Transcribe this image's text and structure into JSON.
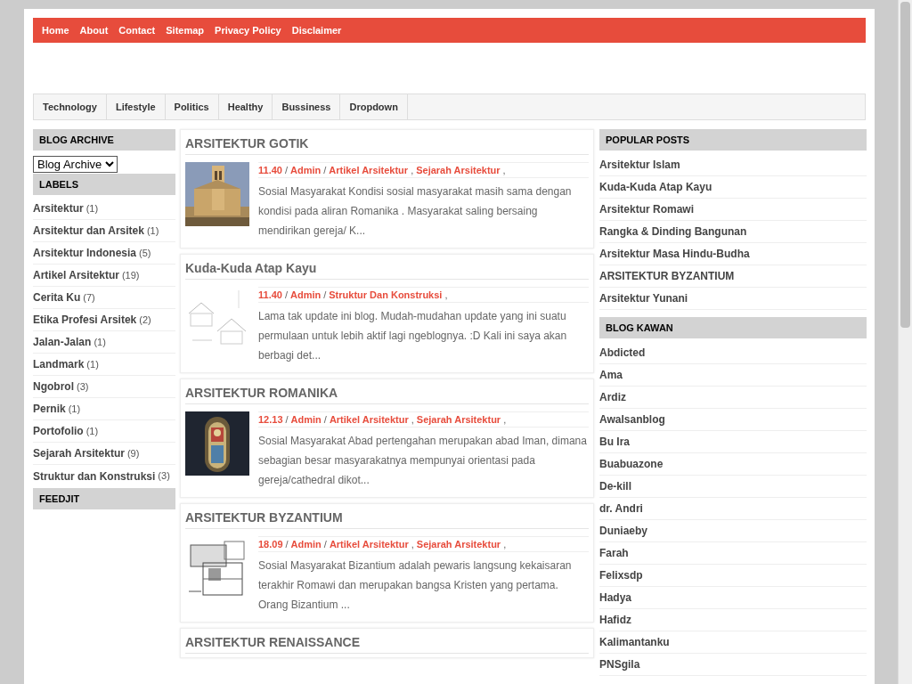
{
  "top_nav": [
    {
      "label": "Home"
    },
    {
      "label": "About"
    },
    {
      "label": "Contact"
    },
    {
      "label": "Sitemap"
    },
    {
      "label": "Privacy Policy"
    },
    {
      "label": "Disclaimer"
    }
  ],
  "category_nav": [
    {
      "label": "Technology"
    },
    {
      "label": "Lifestyle"
    },
    {
      "label": "Politics"
    },
    {
      "label": "Healthy"
    },
    {
      "label": "Bussiness"
    },
    {
      "label": "Dropdown"
    }
  ],
  "left_sidebar": {
    "blog_archive": {
      "title": "BLOG ARCHIVE",
      "select_value": "Blog Archive"
    },
    "labels": {
      "title": "LABELS",
      "items": [
        {
          "name": "Arsitektur",
          "count": "(1)"
        },
        {
          "name": "Arsitektur dan Arsitek",
          "count": "(1)"
        },
        {
          "name": "Arsitektur Indonesia",
          "count": "(5)"
        },
        {
          "name": "Artikel Arsitektur",
          "count": "(19)"
        },
        {
          "name": "Cerita Ku",
          "count": "(7)"
        },
        {
          "name": "Etika Profesi Arsitek",
          "count": "(2)"
        },
        {
          "name": "Jalan-Jalan",
          "count": "(1)"
        },
        {
          "name": "Landmark",
          "count": "(1)"
        },
        {
          "name": "Ngobrol",
          "count": "(3)"
        },
        {
          "name": "Pernik",
          "count": "(1)"
        },
        {
          "name": "Portofolio",
          "count": "(1)"
        },
        {
          "name": "Sejarah Arsitektur",
          "count": "(9)"
        },
        {
          "name": "Struktur dan Konstruksi",
          "count": "(3)"
        }
      ]
    },
    "feedjit": {
      "title": "FEEDJIT"
    }
  },
  "posts": [
    {
      "title": "ARSITEKTUR GOTIK",
      "meta": [
        {
          "kind": "link",
          "text": "11.40"
        },
        {
          "kind": "plain",
          "text": "/"
        },
        {
          "kind": "link",
          "text": "Admin"
        },
        {
          "kind": "plain",
          "text": "/"
        },
        {
          "kind": "link",
          "text": "Artikel Arsitektur"
        },
        {
          "kind": "plain",
          "text": ","
        },
        {
          "kind": "link",
          "text": "Sejarah Arsitektur"
        },
        {
          "kind": "plain",
          "text": ","
        }
      ],
      "snippet": "Sosial Masyarakat Kondisi sosial masyarakat masih sama dengan kondisi pada aliran Romanika . Masyarakat saling bersaing mendirikan gereja/ K..."
    },
    {
      "title": "Kuda-Kuda Atap Kayu",
      "meta": [
        {
          "kind": "link",
          "text": "11.40"
        },
        {
          "kind": "plain",
          "text": "/"
        },
        {
          "kind": "link",
          "text": "Admin"
        },
        {
          "kind": "plain",
          "text": "/"
        },
        {
          "kind": "link",
          "text": "Struktur Dan Konstruksi"
        },
        {
          "kind": "plain",
          "text": ","
        }
      ],
      "snippet": "Lama tak update ini blog. Mudah-mudahan update yang ini suatu permulaan untuk lebih aktif lagi ngeblognya. :D Kali ini saya akan berbagi det..."
    },
    {
      "title": "ARSITEKTUR ROMANIKA",
      "meta": [
        {
          "kind": "link",
          "text": "12.13"
        },
        {
          "kind": "plain",
          "text": "/"
        },
        {
          "kind": "link",
          "text": "Admin"
        },
        {
          "kind": "plain",
          "text": "/"
        },
        {
          "kind": "link",
          "text": "Artikel Arsitektur"
        },
        {
          "kind": "plain",
          "text": ","
        },
        {
          "kind": "link",
          "text": "Sejarah Arsitektur"
        },
        {
          "kind": "plain",
          "text": ","
        }
      ],
      "snippet": "Sosial Masyarakat Abad pertengahan merupakan abad Iman, dimana sebagian besar masyarakatnya mempunyai orientasi pada gereja/cathedral dikot..."
    },
    {
      "title": "ARSITEKTUR BYZANTIUM",
      "meta": [
        {
          "kind": "link",
          "text": "18.09"
        },
        {
          "kind": "plain",
          "text": "/"
        },
        {
          "kind": "link",
          "text": "Admin"
        },
        {
          "kind": "plain",
          "text": "/"
        },
        {
          "kind": "link",
          "text": "Artikel Arsitektur"
        },
        {
          "kind": "plain",
          "text": ","
        },
        {
          "kind": "link",
          "text": "Sejarah Arsitektur"
        },
        {
          "kind": "plain",
          "text": ","
        }
      ],
      "snippet": "Sosial Masyarakat Bizantium adalah pewaris langsung kekaisaran terakhir Romawi dan merupakan bangsa Kristen yang pertama. Orang Bizantium ..."
    },
    {
      "title": "ARSITEKTUR RENAISSANCE"
    }
  ],
  "right_sidebar": {
    "popular_posts": {
      "title": "POPULAR POSTS",
      "items": [
        "Arsitektur Islam",
        "Kuda-Kuda Atap Kayu",
        "Arsitektur Romawi",
        "Rangka & Dinding Bangunan",
        "Arsitektur Masa Hindu-Budha",
        "ARSITEKTUR BYZANTIUM",
        "Arsitektur Yunani"
      ]
    },
    "blog_kawan": {
      "title": "BLOG KAWAN",
      "items": [
        "Abdicted",
        "Ama",
        "Ardiz",
        "Awalsanblog",
        "Bu Ira",
        "Buabuazone",
        "De-kill",
        "dr. Andri",
        "Duniaeby",
        "Farah",
        "Felixsdp",
        "Hadya",
        "Hafidz",
        "Kalimantanku",
        "PNSgila"
      ]
    }
  }
}
